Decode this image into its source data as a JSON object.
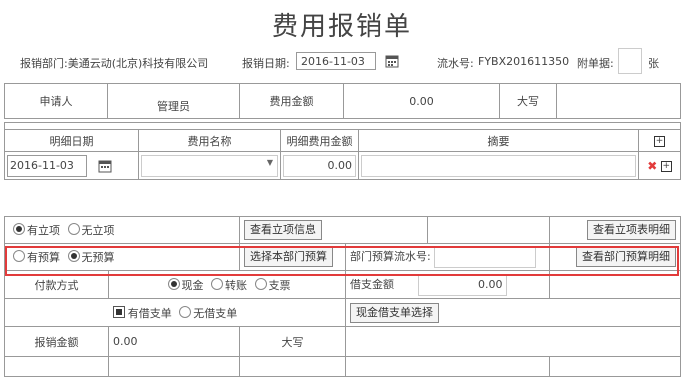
{
  "header": {
    "title": "费用报销单",
    "dept_label": "报销部门:美通云动(北京)科技有限公司",
    "date_label": "报销日期:",
    "date_value": "2016-11-03",
    "serial_label": "流水号:",
    "serial_value": "FYBX201611350",
    "attach_label": "附单据:",
    "attach_unit": "张"
  },
  "summary": {
    "applicant_label": "申请人",
    "applicant_value": "管理员",
    "total_label": "费用金额",
    "total_value": "0.00",
    "capital_label": "大写"
  },
  "detail": {
    "col_date": "明细日期",
    "col_name": "费用名称",
    "col_amount": "明细费用金额",
    "col_summary": "摘要",
    "row_date": "2016-11-03",
    "row_amount": "0.00",
    "add_icon": "plus-box-icon",
    "delete_icon": "red-x-icon"
  },
  "project": {
    "opt_yes": "有立项",
    "opt_no": "无立项",
    "selected": "有立项",
    "view_info_btn": "查看立项信息",
    "view_detail_btn": "查看立项表明细"
  },
  "budget": {
    "opt_yes": "有预算",
    "opt_no": "无预算",
    "selected": "无预算",
    "select_btn": "选择本部门预算",
    "serial_label": "部门预算流水号:",
    "view_btn": "查看部门预算明细"
  },
  "payment": {
    "label": "付款方式",
    "opt_cash": "现金",
    "opt_transfer": "转账",
    "opt_check": "支票",
    "selected": "现金",
    "borrow_label": "借支金额",
    "borrow_value": "0.00"
  },
  "loan": {
    "opt_yes": "有借支单",
    "opt_no": "无借支单",
    "selected": "有借支单",
    "select_btn": "现金借支单选择"
  },
  "reimburse": {
    "label": "报销金额",
    "value": "0.00",
    "capital_label": "大写"
  },
  "colors": {
    "highlight": "#e23b3b",
    "delete": "#e23b3b"
  }
}
